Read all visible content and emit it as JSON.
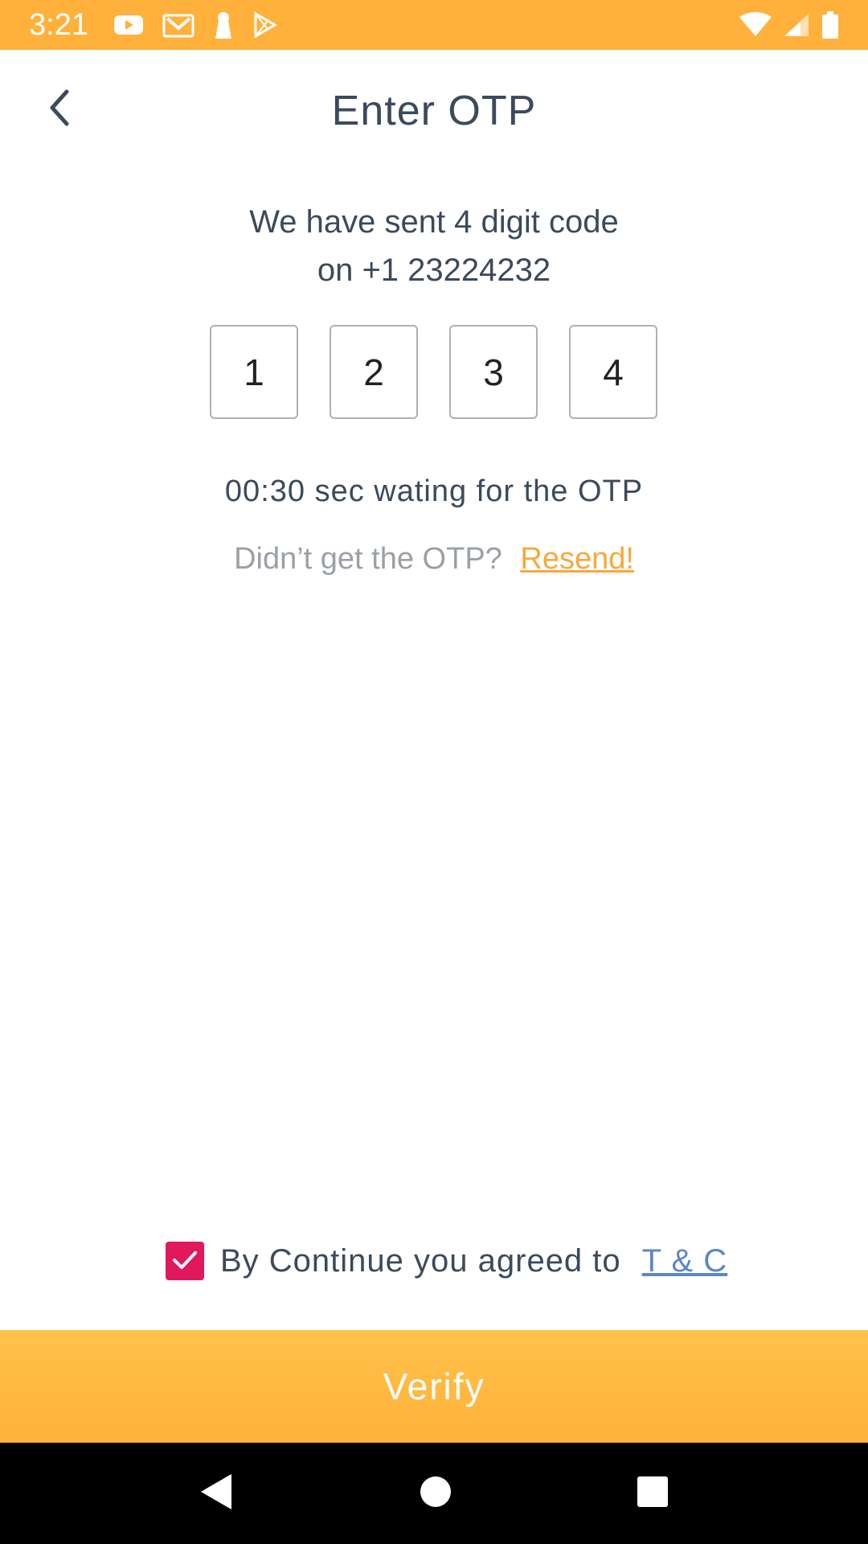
{
  "status_bar": {
    "time": "3:21",
    "icons": [
      "youtube-icon",
      "gmail-icon",
      "keyhole-icon",
      "play-store-icon",
      "wifi-icon",
      "signal-icon",
      "battery-icon"
    ],
    "background": "#FFB13B"
  },
  "header": {
    "title": "Enter OTP",
    "back_icon": "chevron-left-icon"
  },
  "info": {
    "line1": "We have sent 4 digit code",
    "line2": "on +1 23224232"
  },
  "otp": {
    "digits": [
      "1",
      "2",
      "3",
      "4"
    ]
  },
  "timer": {
    "text": "00:30 sec wating for the OTP"
  },
  "resend": {
    "prompt": "Didn’t get the OTP?",
    "link": "Resend!"
  },
  "terms": {
    "checked": true,
    "text": "By Continue you agreed to",
    "link": "T & C"
  },
  "verify": {
    "label": "Verify"
  },
  "colors": {
    "accent": "#FFB13B",
    "resend_link": "#F7A93B",
    "checkbox": "#E0195E",
    "terms_link": "#5B86C9",
    "text": "#3B4A5C"
  }
}
